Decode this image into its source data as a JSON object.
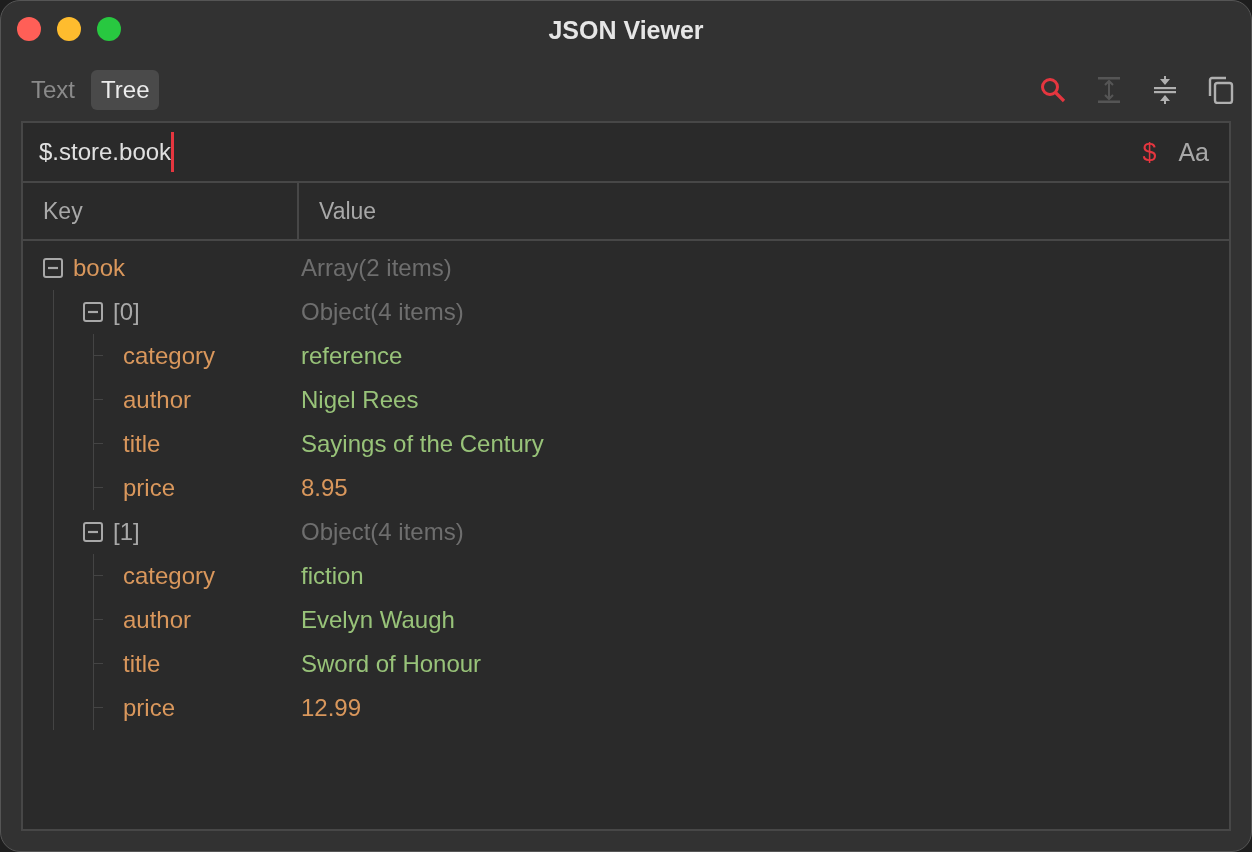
{
  "window": {
    "title": "JSON Viewer"
  },
  "tabs": [
    {
      "label": "Text",
      "selected": false
    },
    {
      "label": "Tree",
      "selected": true
    }
  ],
  "toolbar": [
    {
      "kind": "search",
      "on": true,
      "disabled": false
    },
    {
      "kind": "expand",
      "on": false,
      "disabled": true
    },
    {
      "kind": "collapse",
      "on": false,
      "disabled": false
    },
    {
      "kind": "copy",
      "on": false,
      "disabled": false
    }
  ],
  "query": {
    "value": "$.store.book",
    "options": [
      {
        "label": "$",
        "on": true
      },
      {
        "label": "Aa",
        "on": false
      }
    ]
  },
  "table": {
    "columns": [
      "Key",
      "Value"
    ],
    "tree": [
      {
        "key": "book",
        "value": "Array(2 items)",
        "kind": "array",
        "expanded": true,
        "children": [
          {
            "key": "[0]",
            "value": "Object(4 items)",
            "kind": "element",
            "expanded": true,
            "children": [
              {
                "key": "category",
                "value": "reference",
                "kind": "string"
              },
              {
                "key": "author",
                "value": "Nigel Rees",
                "kind": "string"
              },
              {
                "key": "title",
                "value": "Sayings of the Century",
                "kind": "string"
              },
              {
                "key": "price",
                "value": "8.95",
                "kind": "number"
              }
            ]
          },
          {
            "key": "[1]",
            "value": "Object(4 items)",
            "kind": "element",
            "expanded": true,
            "children": [
              {
                "key": "category",
                "value": "fiction",
                "kind": "string"
              },
              {
                "key": "author",
                "value": "Evelyn Waugh",
                "kind": "string"
              },
              {
                "key": "title",
                "value": "Sword of Honour",
                "kind": "string"
              },
              {
                "key": "price",
                "value": "12.99",
                "kind": "number"
              }
            ]
          }
        ]
      }
    ]
  }
}
